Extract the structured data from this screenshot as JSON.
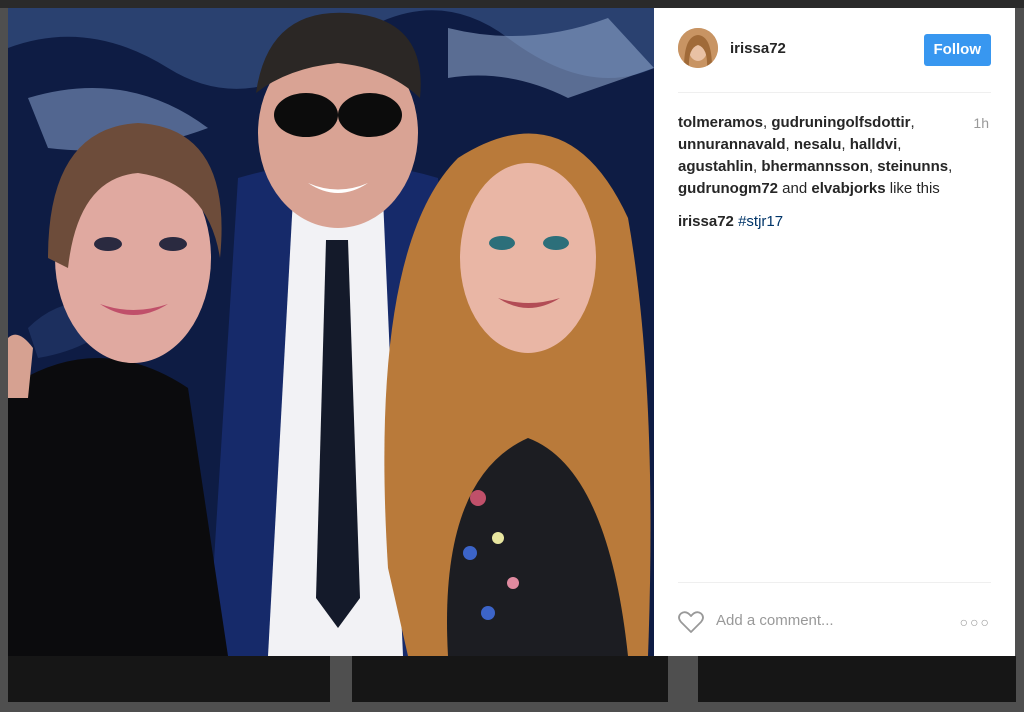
{
  "post": {
    "username": "irissa72",
    "follow_label": "Follow",
    "time_ago": "1h",
    "likes": {
      "users": [
        "tolmeramos",
        "gudruningolfsdottir",
        "unnurannavald",
        "nesalu",
        "halldvi",
        "agustahlin",
        "bhermannsson",
        "steinunns",
        "gudrunogm72"
      ],
      "and_label": "and",
      "last_user": "elvabjorks",
      "suffix": "like this"
    },
    "caption": {
      "username": "irissa72",
      "hashtag": "#stjr17"
    },
    "comment_placeholder": "Add a comment...",
    "more_label": "○○○"
  },
  "icons": {
    "avatar": "user-avatar",
    "like": "heart-icon",
    "options": "more-options-icon"
  },
  "colors": {
    "follow_button": "#3897f0",
    "hashtag": "#003569",
    "text": "#262626",
    "muted": "#999999"
  }
}
